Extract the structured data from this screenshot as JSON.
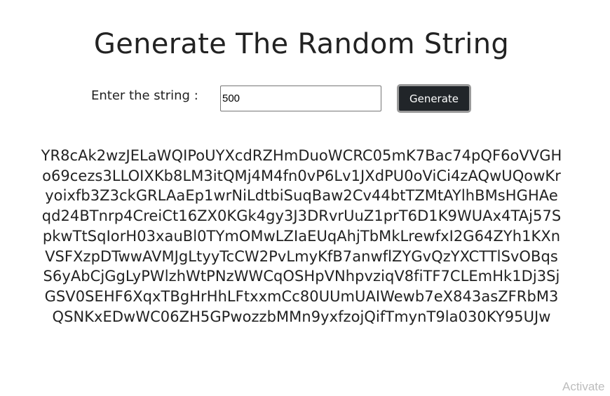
{
  "page": {
    "title": "Generate The Random String"
  },
  "form": {
    "label": "Enter the string :",
    "input_value": "500",
    "button_label": "Generate"
  },
  "output": {
    "text": "YR8cAk2wzJELaWQIPoUYXcdRZHmDuoWCRC05mK7Bac74pQF6oVVGHo69cezs3LLOIXKb8LM3itQMj4M4fn0vP6Lv1JXdPU0oViCi4zAQwUQowKryoixfb3Z3ckGRLAaEp1wrNiLdtbiSuqBaw2Cv44btTZMtAYlhBMsHGHAeqd24BTnrp4CreiCt16ZX0KGk4gy3J3DRvrUuZ1prT6D1K9WUAx4TAj57SpkwTtSqIorH03xauBl0TYmOMwLZIaEUqAhjTbMkLrewfxI2G64ZYh1KXnVSFXzpDTwwAVMJgLtyyTcCW2PvLmyKfB7anwflZYGvQzYXCTTlSvOBqsS6yAbCjGgLyPWlzhWtPNzWWCqOSHpVNhpvziqV8fiTF7CLEmHk1Dj3SjGSV0SEHF6XqxTBgHrHhLFtxxmCc80UUmUAIWewb7eX843asZFRbM3QSNKxEDwWC06ZH5GPwozzbMMn9yxfzojQifTmynT9la030KY95UJw"
  },
  "watermark": {
    "text": "Activate"
  }
}
